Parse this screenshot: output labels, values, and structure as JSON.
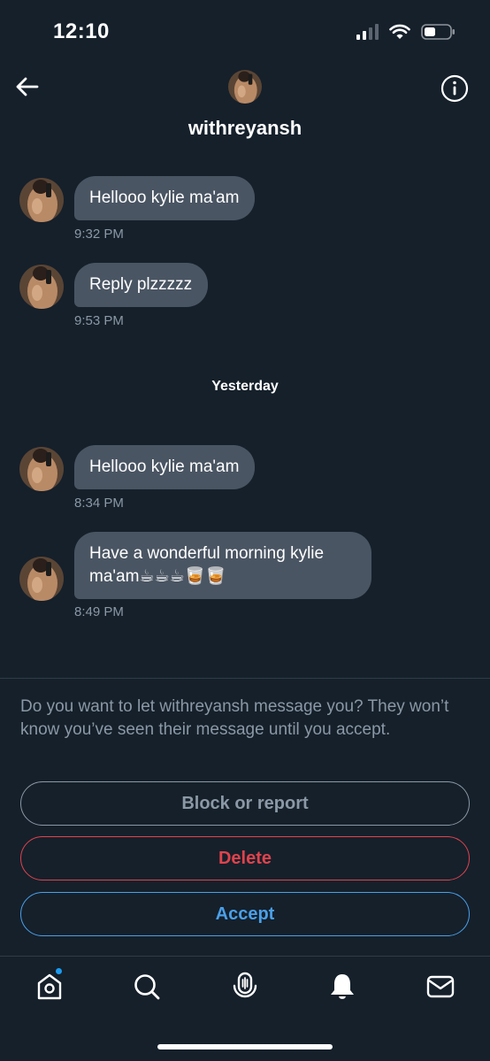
{
  "status_bar": {
    "time": "12:10"
  },
  "header": {
    "username": "withreyansh",
    "back_icon": "arrow-left-icon",
    "info_icon": "info-circle-icon"
  },
  "messages": [
    {
      "text": "Hellooo kylie ma'am",
      "time": "9:32 PM"
    },
    {
      "text": "Reply plzzzzz",
      "time": "9:53 PM"
    },
    {
      "text": "Hellooo kylie ma'am",
      "time": "8:34 PM"
    },
    {
      "text": "Have a wonderful morning kylie ma'am☕☕☕🥃🥃",
      "time": "8:49 PM"
    }
  ],
  "day_separator": "Yesterday",
  "request": {
    "prompt": "Do you want to let withreyansh message you? They won’t know you’ve seen their message until you accept.",
    "block_label": "Block or report",
    "delete_label": "Delete",
    "accept_label": "Accept"
  },
  "tabbar": {
    "items": [
      "home-icon",
      "search-icon",
      "spaces-icon",
      "notifications-icon",
      "messages-icon"
    ],
    "home_has_badge": true
  },
  "colors": {
    "background": "#15202b",
    "bubble": "#4a5563",
    "muted_text": "#8b98a5",
    "delete": "#e0434c",
    "accent": "#4aa0e8"
  }
}
